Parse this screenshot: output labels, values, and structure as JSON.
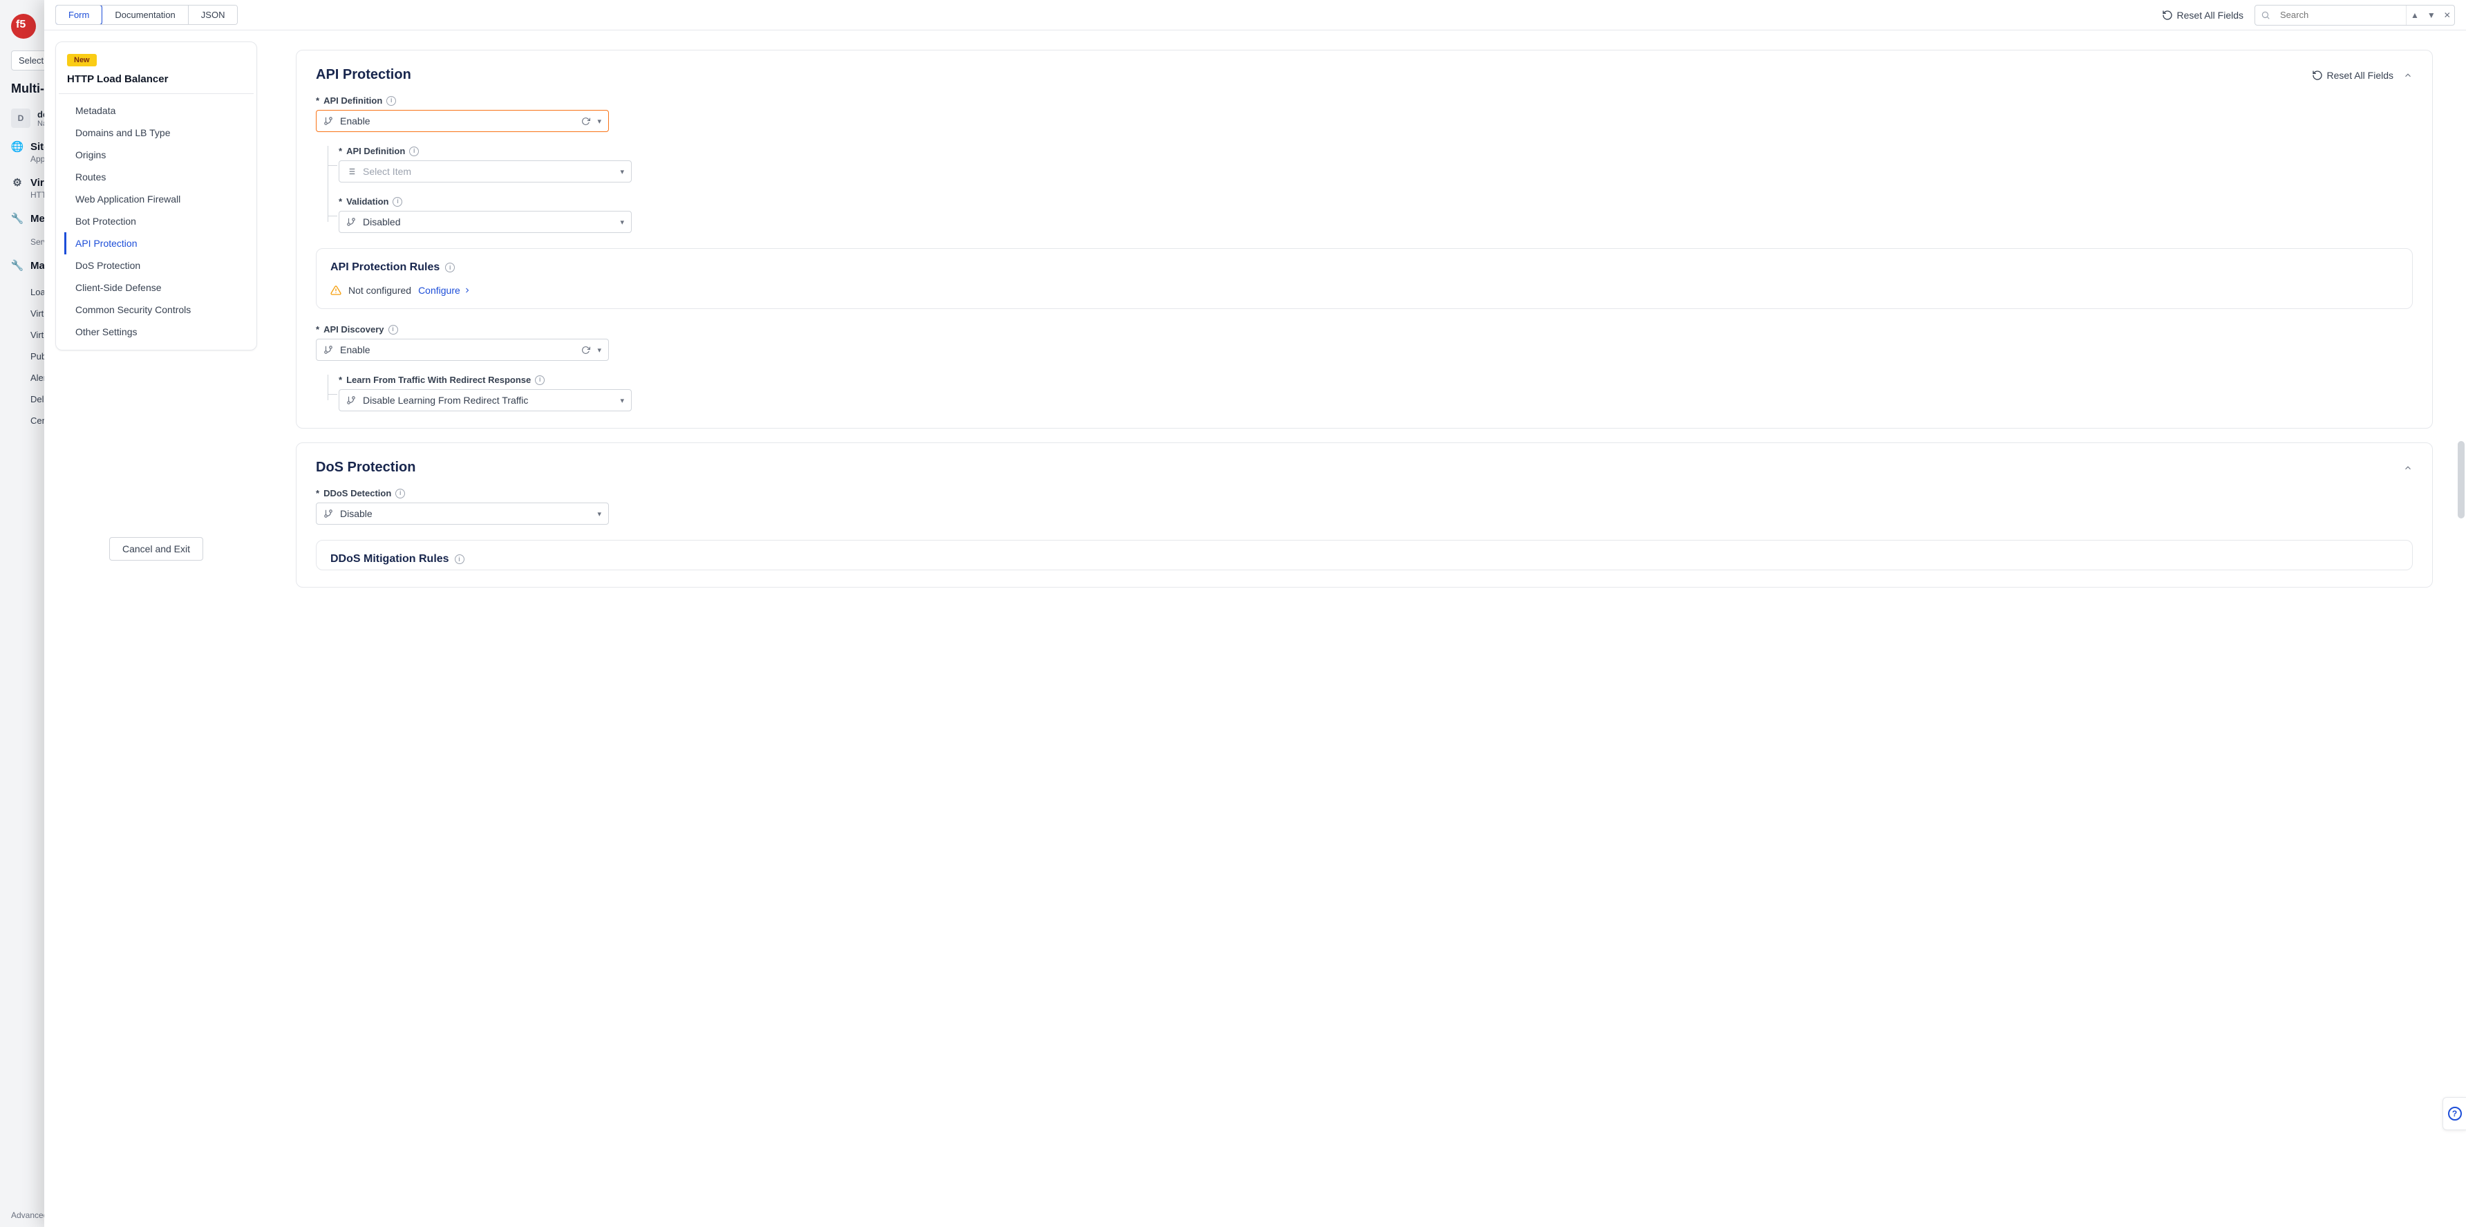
{
  "bg": {
    "select_service_label": "Select service",
    "title": "Multi-Cloud",
    "avatar_letter": "D",
    "avatar_name": "default",
    "avatar_sub": "Namespace",
    "groups": [
      {
        "name": "Sites",
        "sub": "App Sites",
        "icon": "globe"
      },
      {
        "name": "Virtual",
        "sub": "HTTP",
        "icon": "sliders"
      },
      {
        "name": "Mesh",
        "sub": "",
        "icon": "wrench"
      }
    ],
    "services_label": "Services",
    "sublist": [
      "Load",
      "Virtu",
      "Virtu",
      "Publi",
      "Alert",
      "Delegated Management",
      "Certificates"
    ],
    "manage_label": "Manage",
    "footer": "Advanced"
  },
  "top": {
    "tabs": [
      "Form",
      "Documentation",
      "JSON"
    ],
    "active_tab": "Form",
    "reset_label": "Reset All Fields",
    "search_placeholder": "Search"
  },
  "leftnav": {
    "badge": "New",
    "title": "HTTP Load Balancer",
    "items": [
      {
        "label": "Metadata"
      },
      {
        "label": "Domains and LB Type"
      },
      {
        "label": "Origins"
      },
      {
        "label": "Routes"
      },
      {
        "label": "Web Application Firewall"
      },
      {
        "label": "Bot Protection"
      },
      {
        "label": "API Protection",
        "active": true
      },
      {
        "label": "DoS Protection"
      },
      {
        "label": "Client-Side Defense"
      },
      {
        "label": "Common Security Controls"
      },
      {
        "label": "Other Settings"
      }
    ],
    "cancel_label": "Cancel and Exit"
  },
  "main": {
    "api_protection": {
      "title": "API Protection",
      "reset_label": "Reset All Fields",
      "api_definition_label": "API Definition",
      "api_definition_value": "Enable",
      "api_definition_inner_label": "API Definition",
      "api_definition_inner_placeholder": "Select Item",
      "validation_label": "Validation",
      "validation_value": "Disabled",
      "rules_title": "API Protection Rules",
      "rules_status": "Not configured",
      "rules_configure": "Configure",
      "api_discovery_label": "API Discovery",
      "api_discovery_value": "Enable",
      "learn_label": "Learn From Traffic With Redirect Response",
      "learn_value": "Disable Learning From Redirect Traffic"
    },
    "dos": {
      "title": "DoS Protection",
      "ddos_detection_label": "DDoS Detection",
      "ddos_detection_value": "Disable",
      "mitigation_title": "DDoS Mitigation Rules"
    }
  }
}
